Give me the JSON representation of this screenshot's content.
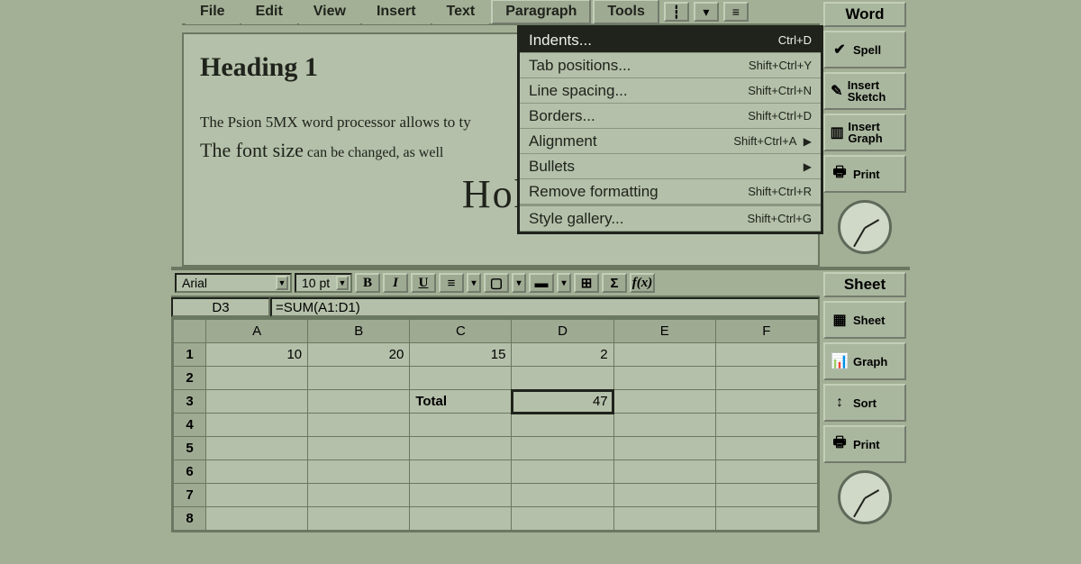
{
  "word": {
    "app_name": "Word",
    "menu": [
      "File",
      "Edit",
      "View",
      "Insert",
      "Text",
      "Paragraph",
      "Tools"
    ],
    "dropdown": {
      "open_index": 5,
      "highlight_index": 0,
      "items": [
        {
          "label": "Indents...",
          "shortcut": "Ctrl+D",
          "submenu": false
        },
        {
          "label": "Tab positions...",
          "shortcut": "Shift+Ctrl+Y",
          "submenu": false
        },
        {
          "label": "Line spacing...",
          "shortcut": "Shift+Ctrl+N",
          "submenu": false
        },
        {
          "label": "Borders...",
          "shortcut": "Shift+Ctrl+D",
          "submenu": false
        },
        {
          "label": "Alignment",
          "shortcut": "Shift+Ctrl+A",
          "submenu": true
        },
        {
          "label": "Bullets",
          "shortcut": "",
          "submenu": true
        },
        {
          "label": "Remove formatting",
          "shortcut": "Shift+Ctrl+R",
          "submenu": false
        },
        {
          "sep": true
        },
        {
          "label": "Style gallery...",
          "shortcut": "Shift+Ctrl+G",
          "submenu": false
        }
      ]
    },
    "sidebar": [
      {
        "icon": "✔",
        "label": "Spell"
      },
      {
        "icon": "✎",
        "label": "Insert Sketch"
      },
      {
        "icon": "▥",
        "label": "Insert Graph"
      },
      {
        "icon": "🖶",
        "label": "Print"
      }
    ],
    "doc": {
      "heading": "Heading 1",
      "line1": "The Psion 5MX word processor allows to ty",
      "line2a": "The font size",
      "line2b": " can be changed, as well",
      "handwriting": "Holl"
    }
  },
  "sheet": {
    "app_name": "Sheet",
    "toolbar": {
      "font": "Arial",
      "size": "10 pt",
      "bold": "B",
      "italic": "I",
      "underline": "U",
      "sigma": "Σ",
      "fx": "f(x)"
    },
    "cell_ref": "D3",
    "formula": "=SUM(A1:D1)",
    "columns": [
      "A",
      "B",
      "C",
      "D",
      "E",
      "F"
    ],
    "rows": [
      "1",
      "2",
      "3",
      "4",
      "5",
      "6",
      "7",
      "8"
    ],
    "cells": {
      "A1": "10",
      "B1": "20",
      "C1": "15",
      "D1": "2",
      "C3": "Total",
      "D3": "47"
    },
    "selected": "D3",
    "sidebar": [
      {
        "icon": "▦",
        "label": "Sheet"
      },
      {
        "icon": "📊",
        "label": "Graph"
      },
      {
        "icon": "↕",
        "label": "Sort"
      },
      {
        "icon": "🖶",
        "label": "Print"
      }
    ]
  }
}
